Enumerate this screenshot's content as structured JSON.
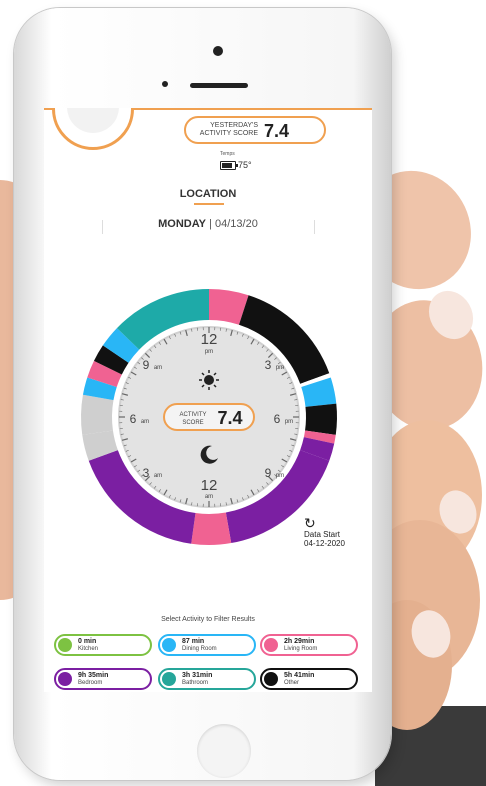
{
  "header": {
    "yesterday_label_1": "YESTERDAY'S",
    "yesterday_label_2": "ACTIVITY SCORE",
    "yesterday_score": "7.4",
    "temp_label": "Temps",
    "temp_value": "75°"
  },
  "location": {
    "title": "LOCATION",
    "day": "MONDAY",
    "date": "04/13/20"
  },
  "dial": {
    "score_label_1": "ACTIVITY",
    "score_label_2": "SCORE",
    "score": "7.4",
    "labels": {
      "top": "12",
      "top_sub": "pm",
      "bottom": "12",
      "bottom_sub": "am",
      "h9am": "9",
      "h9am_sub": "am",
      "h3pm": "3",
      "h3pm_sub": "pm",
      "h6am": "6",
      "h6am_sub": "am",
      "h6pm": "6",
      "h6pm_sub": "pm",
      "h3am": "3",
      "h3am_sub": "am",
      "h9pm": "9",
      "h9pm_sub": "pm"
    },
    "icons": [
      "sun-icon",
      "moon-icon"
    ],
    "ring_colors": {
      "kitchen": "#7dc242",
      "dining": "#29b6f6",
      "living": "#f06292",
      "bedroom": "#7b1fa2",
      "bathroom": "#26a69a",
      "other": "#111111",
      "teal": "#1eaaa8",
      "none": "#cfcfcf"
    }
  },
  "data_start": {
    "label": "Data Start",
    "date": "04-12-2020"
  },
  "filter": {
    "label": "Select Activity to Filter Results",
    "chips": [
      {
        "value": "0 min",
        "name": "Kitchen",
        "color": "#7dc242"
      },
      {
        "value": "87 min",
        "name": "Dining Room",
        "color": "#29b6f6"
      },
      {
        "value": "2h 29min",
        "name": "Living Room",
        "color": "#f06292"
      },
      {
        "value": "9h 35min",
        "name": "Bedroom",
        "color": "#7b1fa2"
      },
      {
        "value": "3h 31min",
        "name": "Bathroom",
        "color": "#26a69a"
      },
      {
        "value": "5h 41min",
        "name": "Other",
        "color": "#111111"
      }
    ]
  }
}
